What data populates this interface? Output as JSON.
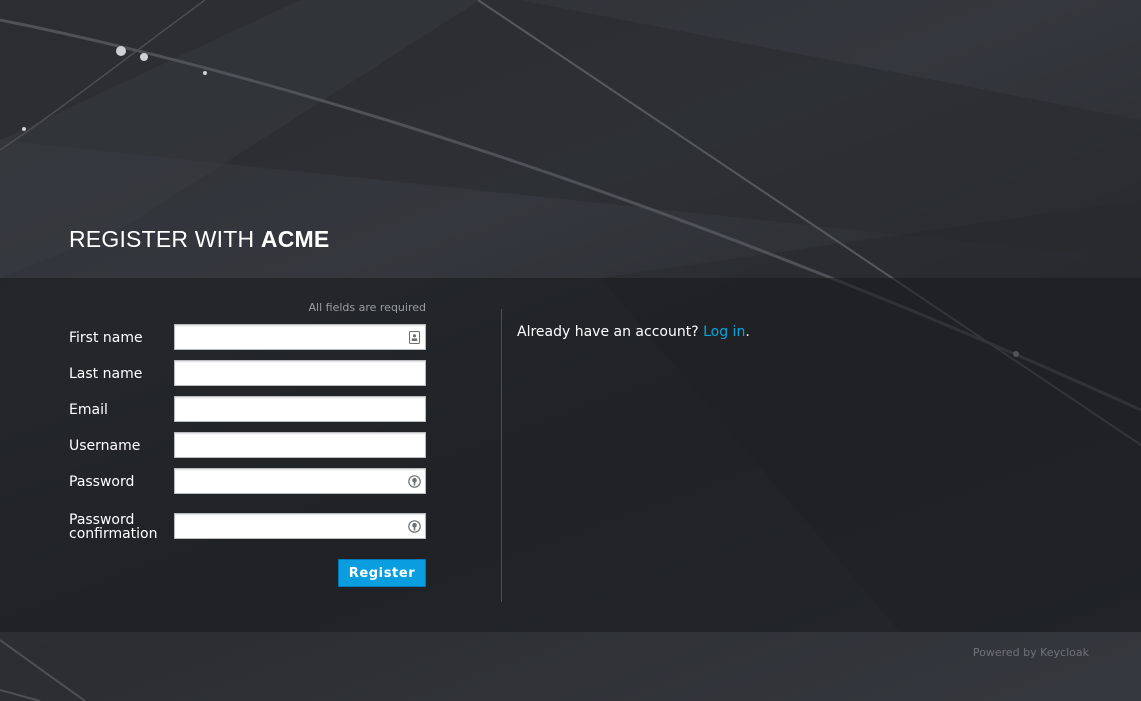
{
  "header": {
    "title_prefix": "REGISTER WITH",
    "title_brand": "ACME"
  },
  "form": {
    "required_note": "All fields are required",
    "fields": [
      {
        "label": "First name",
        "value": "",
        "icon": "contact-card-icon"
      },
      {
        "label": "Last name",
        "value": ""
      },
      {
        "label": "Email",
        "value": ""
      },
      {
        "label": "Username",
        "value": ""
      },
      {
        "label": "Password",
        "value": "",
        "icon": "password-key-icon"
      },
      {
        "label": "Password confirmation",
        "value": "",
        "icon": "password-key-icon"
      }
    ],
    "register_label": "Register"
  },
  "login": {
    "prompt": "Already have an account?",
    "link_label": "Log in",
    "suffix": "."
  },
  "footer": {
    "powered_by": "Powered by Keycloak"
  },
  "colors": {
    "accent": "#0a9ee0",
    "link": "#00a8e1",
    "background": "#2e3035"
  }
}
